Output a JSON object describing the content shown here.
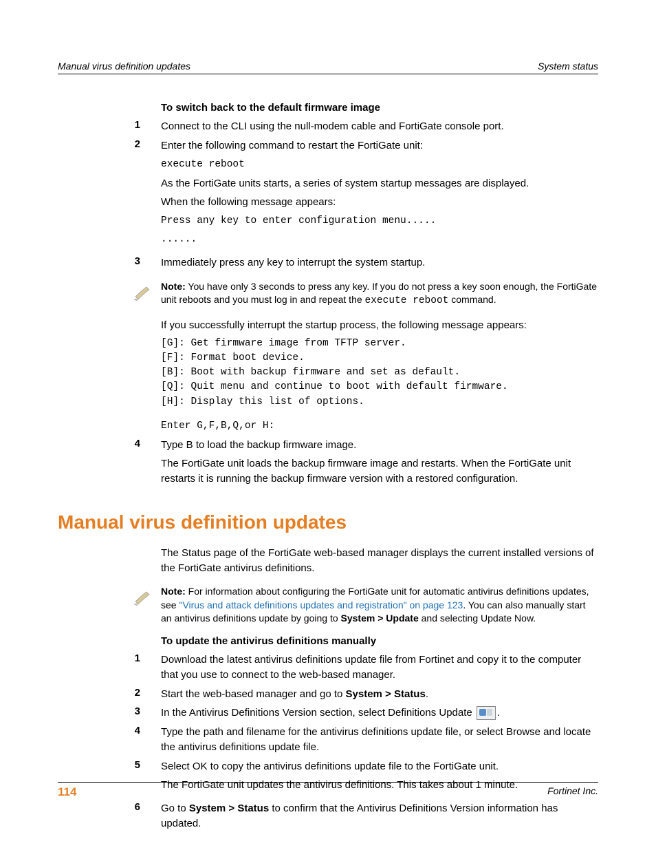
{
  "header": {
    "left": "Manual virus definition updates",
    "right": "System status"
  },
  "section1": {
    "heading": "To switch back to the default firmware image",
    "step1": {
      "num": "1",
      "text": "Connect to the CLI using the null-modem cable and FortiGate console port."
    },
    "step2": {
      "num": "2",
      "line1": "Enter the following command to restart the FortiGate unit:",
      "cmd": "execute reboot",
      "line2": "As the FortiGate units starts, a series of system startup messages are displayed.",
      "line3": "When the following message appears:",
      "msg1": "Press any key to enter configuration menu.....",
      "msg2": "......"
    },
    "step3": {
      "num": "3",
      "text": "Immediately press any key to interrupt the system startup."
    },
    "note1": {
      "label": "Note:",
      "part1": " You have only 3 seconds to press any key. If you do not press a key soon enough, the FortiGate unit reboots and you must log in and repeat the ",
      "cmd": "execute reboot",
      "part2": " command."
    },
    "after_note": "If you successfully interrupt the startup process, the following message appears:",
    "menu": {
      "l1": "[G]:  Get firmware image from TFTP server.",
      "l2": "[F]:  Format boot device.",
      "l3": "[B]:  Boot with backup firmware and set as default.",
      "l4": "[Q]:  Quit menu and continue to boot with default firmware.",
      "l5": "[H]:  Display this list of options.",
      "l6": "Enter G,F,B,Q,or H:"
    },
    "step4": {
      "num": "4",
      "line1": "Type B to load the backup firmware image.",
      "line2": "The FortiGate unit loads the backup firmware image and restarts. When the FortiGate unit restarts it is running the backup firmware version with a restored configuration."
    }
  },
  "section2": {
    "heading": "Manual virus definition updates",
    "intro": "The Status page of the FortiGate web-based manager displays the current installed versions of the FortiGate antivirus definitions.",
    "note2": {
      "label": "Note:",
      "part1": " For information about configuring the FortiGate unit for automatic antivirus definitions updates, see ",
      "link": "\"Virus and attack definitions updates and registration\" on page 123",
      "part2": ". You can also manually start an antivirus definitions update by going to ",
      "bold": "System > Update",
      "part3": " and selecting Update Now."
    },
    "subheading": "To update the antivirus definitions manually",
    "s1": {
      "num": "1",
      "text": "Download the latest antivirus definitions update file from Fortinet and copy it to the computer that you use to connect to the web-based manager."
    },
    "s2": {
      "num": "2",
      "pre": "Start the web-based manager and go to ",
      "bold": "System > Status",
      "post": "."
    },
    "s3": {
      "num": "3",
      "pre": "In the Antivirus Definitions Version section, select Definitions Update ",
      "post": "."
    },
    "s4": {
      "num": "4",
      "text": "Type the path and filename for the antivirus definitions update file, or select Browse and locate the antivirus definitions update file."
    },
    "s5": {
      "num": "5",
      "line1": "Select OK to copy the antivirus definitions update file to the FortiGate unit.",
      "line2": "The FortiGate unit updates the antivirus definitions. This takes about 1 minute."
    },
    "s6": {
      "num": "6",
      "pre": "Go to ",
      "bold": "System > Status",
      "post": " to confirm that the Antivirus Definitions Version information has updated."
    }
  },
  "footer": {
    "page": "114",
    "right": "Fortinet Inc."
  }
}
